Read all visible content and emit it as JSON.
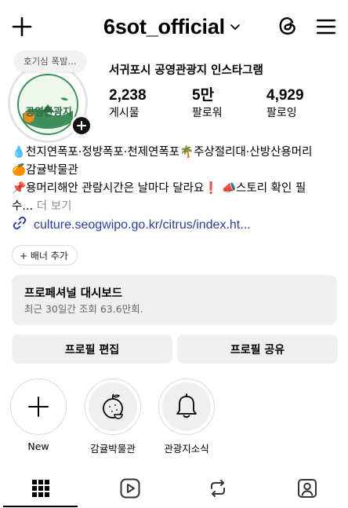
{
  "header": {
    "username": "6sot_official"
  },
  "profile": {
    "note": "호기심 폭발...",
    "avatar_text": "공영관광지",
    "display_name": "서귀포시 공영관광지 인스타그램",
    "stats": [
      {
        "value": "2,238",
        "label": "게시물"
      },
      {
        "value": "5만",
        "label": "팔로워"
      },
      {
        "value": "4,929",
        "label": "팔로잉"
      }
    ]
  },
  "bio": {
    "line1": "💧천지연폭포·정방폭포·천제연폭포🌴주상절리대·산방산용머리",
    "line2": "🍊감귤박물관",
    "line3": "📌용머리해안 관람시간은 날마다 달라요❗ 📣스토리 확인 필",
    "line4": "수...",
    "more": "더 보기",
    "link": "culture.seogwipo.go.kr/citrus/index.ht..."
  },
  "banner_chip": "+ 배너 추가",
  "dashboard": {
    "title": "프로페셔널 대시보드",
    "subtitle": "최근 30일간 조회 63.6만회."
  },
  "buttons": {
    "edit": "프로필 편집",
    "share": "프로필 공유"
  },
  "highlights": [
    {
      "label": "New",
      "icon": "plus-icon"
    },
    {
      "label": "감귤박물관",
      "icon": "citrus-icon"
    },
    {
      "label": "관광지소식",
      "icon": "bell-icon"
    }
  ],
  "tabs": [
    {
      "name": "grid",
      "icon": "grid-icon",
      "active": true
    },
    {
      "name": "reels",
      "icon": "reels-icon",
      "active": false
    },
    {
      "name": "reposts",
      "icon": "repost-icon",
      "active": false
    },
    {
      "name": "tagged",
      "icon": "tagged-icon",
      "active": false
    }
  ],
  "colors": {
    "link": "#2a3f9d",
    "button_bg": "#efefef",
    "avatar_green": "#3f8f5a",
    "avatar_orange": "#ef8a1c"
  }
}
